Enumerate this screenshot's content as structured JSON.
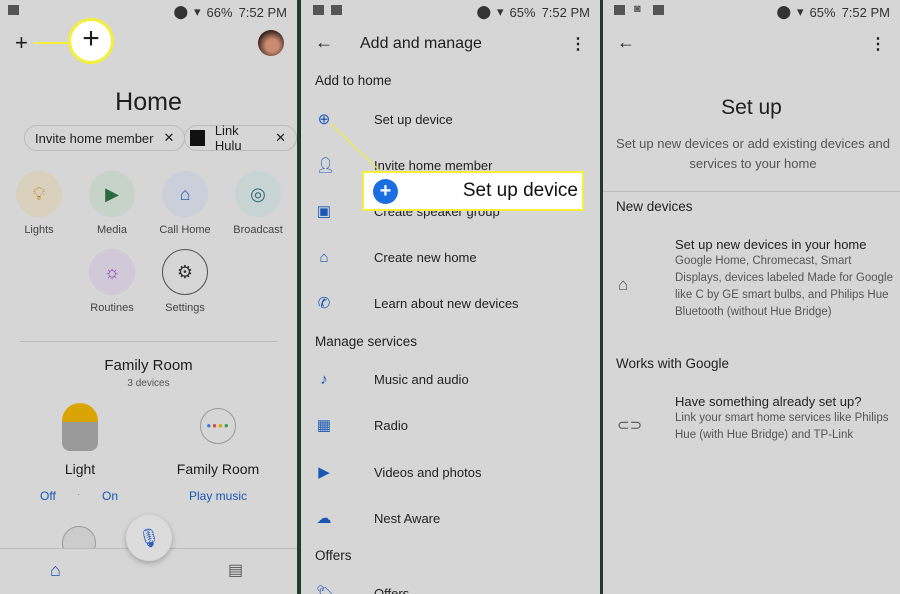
{
  "panel1": {
    "status": {
      "battery": "66%",
      "time": "7:52 PM"
    },
    "title": "Home",
    "chips": [
      {
        "label": "Invite home member"
      },
      {
        "label": "Link Hulu",
        "logo": "hulu"
      }
    ],
    "tiles": [
      {
        "label": "Lights",
        "icon": "lightbulb-icon"
      },
      {
        "label": "Media",
        "icon": "media-icon"
      },
      {
        "label": "Call Home",
        "icon": "call-home-icon"
      },
      {
        "label": "Broadcast",
        "icon": "broadcast-icon"
      },
      {
        "label": "Routines",
        "icon": "routines-icon"
      },
      {
        "label": "Settings",
        "icon": "gear-icon"
      }
    ],
    "room": {
      "name": "Family Room",
      "count": "3 devices"
    },
    "devices": [
      {
        "name": "Light",
        "actions": [
          "Off",
          "On"
        ]
      },
      {
        "name": "Family Room",
        "actions": [
          "Play music"
        ]
      }
    ]
  },
  "panel2": {
    "status": {
      "battery": "65%",
      "time": "7:52 PM"
    },
    "title": "Add and manage",
    "sections": [
      {
        "title": "Add to home",
        "items": [
          "Set up device",
          "Invite home member",
          "Create speaker group",
          "Create new home",
          "Learn about new devices"
        ]
      },
      {
        "title": "Manage services",
        "items": [
          "Music and audio",
          "Radio",
          "Videos and photos",
          "Nest Aware"
        ]
      },
      {
        "title": "Offers",
        "items": [
          "Offers"
        ]
      }
    ],
    "callout": "Set up device"
  },
  "panel3": {
    "status": {
      "battery": "65%",
      "time": "7:52 PM"
    },
    "title": "Set up",
    "subtitle": "Set up new devices or add existing devices and services to your home",
    "sections": [
      {
        "title": "New devices",
        "item_title": "Set up new devices in your home",
        "item_desc": "Google Home, Chromecast, Smart Displays, devices labeled Made for Google like C by GE smart bulbs, and Philips Hue Bluetooth (without Hue Bridge)"
      },
      {
        "title": "Works with Google",
        "item_title": "Have something already set up?",
        "item_desc": "Link your smart home services like Philips Hue (with Hue Bridge) and TP-Link"
      }
    ]
  },
  "colors": {
    "accent": "#1a57b5",
    "highlight": "#f3ef3a"
  }
}
